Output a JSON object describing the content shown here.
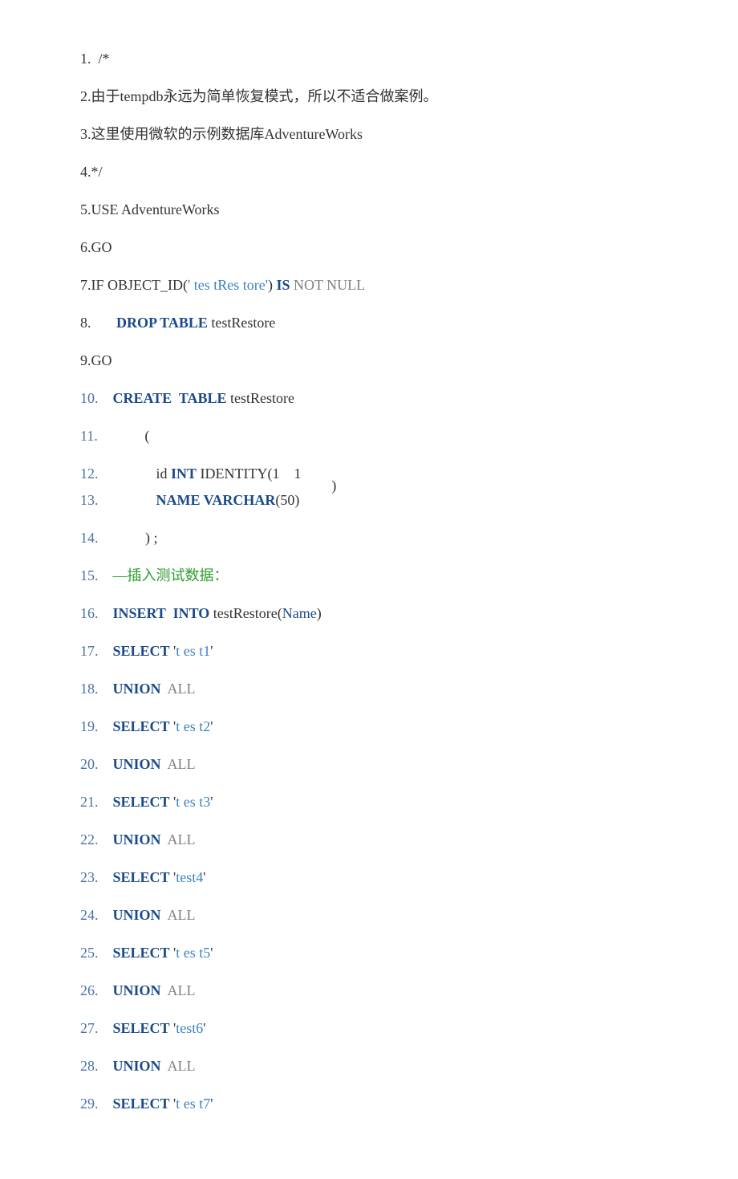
{
  "lines": {
    "l1": {
      "n": "1.",
      "t": "  /*"
    },
    "l2": {
      "n": "2.",
      "t": "由于tempdb永远为简单恢复模式，所以不适合做案例。"
    },
    "l3": {
      "n": "3.",
      "t": "这里使用微软的示例数据库AdventureWorks"
    },
    "l4": {
      "n": "4.",
      "t": "*/"
    },
    "l5": {
      "n": "5.",
      "t": "USE AdventureWorks"
    },
    "l6": {
      "n": "6.",
      "t": "GO"
    },
    "l7": {
      "n": "7.",
      "a": "IF OBJECT_ID(",
      "b": "' tes tRes tore'",
      "c": ") ",
      "is": "IS",
      "nn": " NOT NULL"
    },
    "l8": {
      "n": "8.",
      "drop": "DROP TABLE",
      "t": " testRestore"
    },
    "l9": {
      "n": "9.",
      "t": "GO"
    },
    "l10": {
      "n": "10.",
      "create": "CREATE  TABLE",
      "t": " testRestore"
    },
    "l11": {
      "n": "11.",
      "t": "         ("
    },
    "l12": {
      "n": "12.",
      "a": "            id ",
      "int": "INT",
      "b": " IDENTITY(1    1"
    },
    "l13": {
      "n": "13.",
      "name": "NAME",
      "varchar": " VARCHAR",
      "t": "(50)",
      "paren": ")"
    },
    "l14": {
      "n": "14.",
      "t": "         ) ;"
    },
    "l15": {
      "n": "15.",
      "t": "—插入测试数据："
    },
    "l16": {
      "n": "16.",
      "ins": "INSERT  INTO",
      "a": " testRestore(",
      "name": "Name",
      "b": ")"
    },
    "l17": {
      "n": "17.",
      "sel": "SELECT",
      "q1": " '",
      "str": "t es t1",
      "q2": "'"
    },
    "l18": {
      "n": "18.",
      "u": "UNION",
      "a": "  ALL"
    },
    "l19": {
      "n": "19.",
      "sel": "SELECT",
      "q1": " '",
      "str": "t es t2",
      "q2": "'"
    },
    "l20": {
      "n": "20.",
      "u": "UNION",
      "a": "  ALL"
    },
    "l21": {
      "n": "21.",
      "sel": "SELECT",
      "q1": " '",
      "str": "t es t3",
      "q2": "'"
    },
    "l22": {
      "n": "22.",
      "u": "UNION",
      "a": "  ALL"
    },
    "l23": {
      "n": "23.",
      "sel": "SELECT",
      "q1": " '",
      "str": "test4",
      "q2": "'"
    },
    "l24": {
      "n": "24.",
      "u": "UNION",
      "a": "  ALL"
    },
    "l25": {
      "n": "25.",
      "sel": "SELECT",
      "q1": " '",
      "str": "t es t5",
      "q2": "'"
    },
    "l26": {
      "n": "26.",
      "u": "UNION",
      "a": "  ALL"
    },
    "l27": {
      "n": "27.",
      "sel": "SELECT",
      "q1": " '",
      "str": "test6",
      "q2": "'"
    },
    "l28": {
      "n": "28.",
      "u": "UNION",
      "a": "  ALL"
    },
    "l29": {
      "n": "29.",
      "sel": "SELECT",
      "q1": " '",
      "str": "t es t7",
      "q2": "'"
    }
  }
}
